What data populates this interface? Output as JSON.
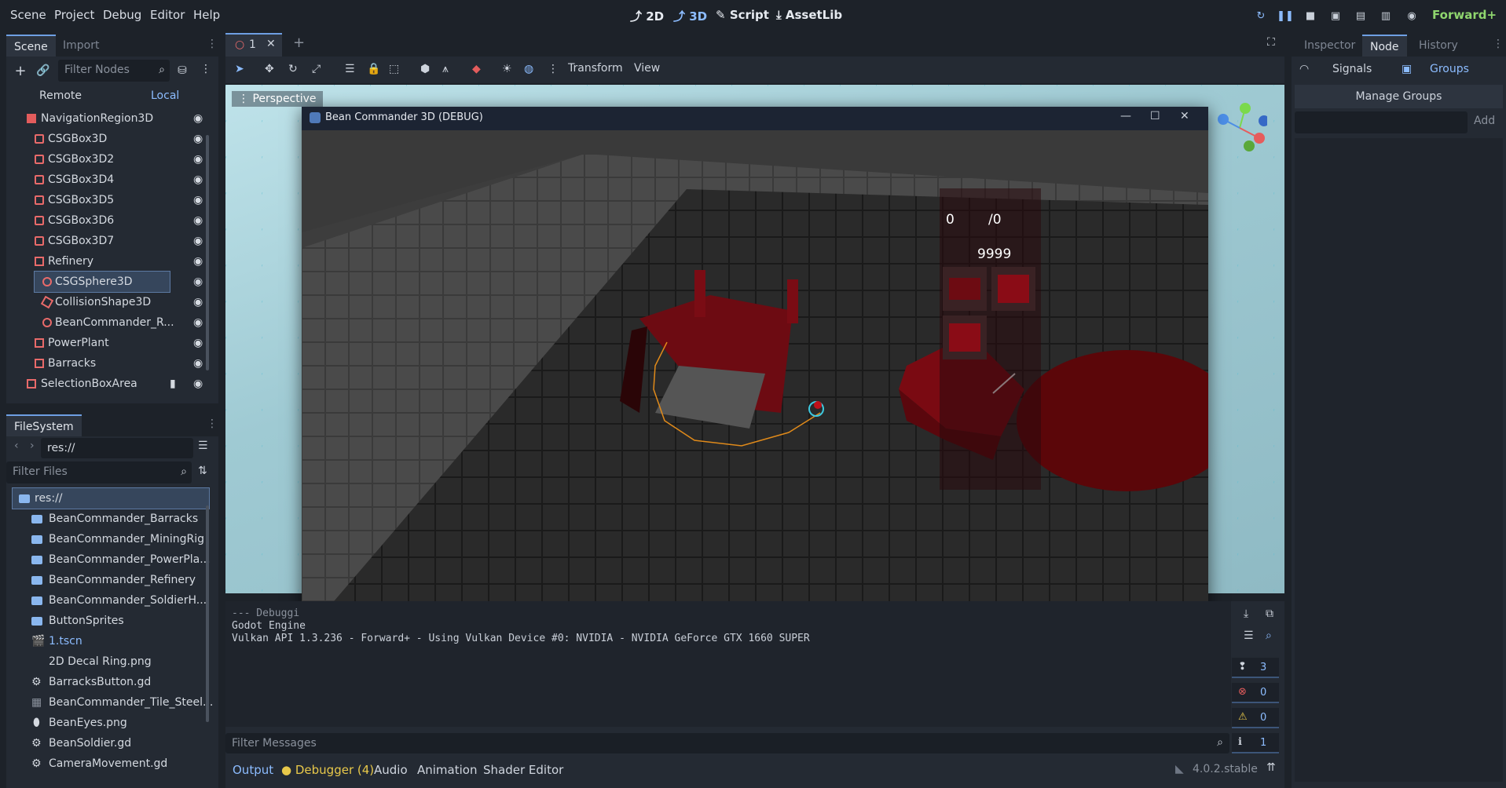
{
  "menu": [
    "Scene",
    "Project",
    "Debug",
    "Editor",
    "Help"
  ],
  "modes": [
    {
      "label": "2D"
    },
    {
      "label": "3D"
    },
    {
      "label": "Script"
    },
    {
      "label": "AssetLib"
    }
  ],
  "renderer": "Forward+",
  "scene_dock": {
    "tabs": [
      "Scene",
      "Import"
    ],
    "filter_placeholder": "Filter Nodes",
    "remote": "Remote",
    "local": "Local",
    "nodes": [
      {
        "label": "NavigationRegion3D"
      },
      {
        "label": "CSGBox3D"
      },
      {
        "label": "CSGBox3D2"
      },
      {
        "label": "CSGBox3D4"
      },
      {
        "label": "CSGBox3D5"
      },
      {
        "label": "CSGBox3D6"
      },
      {
        "label": "CSGBox3D7"
      },
      {
        "label": "Refinery"
      },
      {
        "label": "CSGSphere3D"
      },
      {
        "label": "CollisionShape3D"
      },
      {
        "label": "BeanCommander_R..."
      },
      {
        "label": "PowerPlant"
      },
      {
        "label": "Barracks"
      },
      {
        "label": "SelectionBoxArea"
      }
    ]
  },
  "filesystem": {
    "tab": "FileSystem",
    "path": "res://",
    "filter_placeholder": "Filter Files",
    "items": [
      {
        "label": "res://"
      },
      {
        "label": "BeanCommander_Barracks"
      },
      {
        "label": "BeanCommander_MiningRig"
      },
      {
        "label": "BeanCommander_PowerPla..."
      },
      {
        "label": "BeanCommander_Refinery"
      },
      {
        "label": "BeanCommander_SoldierH..."
      },
      {
        "label": "ButtonSprites"
      },
      {
        "label": "1.tscn"
      },
      {
        "label": "2D Decal Ring.png"
      },
      {
        "label": "BarracksButton.gd"
      },
      {
        "label": "BeanCommander_Tile_Steel..."
      },
      {
        "label": "BeanEyes.png"
      },
      {
        "label": "BeanSoldier.gd"
      },
      {
        "label": "CameraMovement.gd"
      }
    ]
  },
  "editor_tab": {
    "label": "1"
  },
  "toolbar": {
    "transform": "Transform",
    "view": "View"
  },
  "viewport": {
    "label": "Perspective"
  },
  "game_window": {
    "title": "Bean Commander 3D (DEBUG)",
    "hud": {
      "left_count": "0",
      "right_count": "/0",
      "money": "9999"
    }
  },
  "output": {
    "lines": [
      "--- Debuggi",
      "Godot Engine",
      "Vulkan API 1.3.236 - Forward+ - Using Vulkan Device #0: NVIDIA - NVIDIA GeForce GTX 1660 SUPER"
    ],
    "filter_placeholder": "Filter Messages",
    "counts": {
      "messages": "3",
      "errors": "0",
      "warnings": "0",
      "info": "1"
    }
  },
  "bottom_tabs": [
    "Output",
    "Debugger (4)",
    "Audio",
    "Animation",
    "Shader Editor"
  ],
  "version": "4.0.2.stable",
  "inspector": {
    "tabs": [
      "Inspector",
      "Node",
      "History"
    ],
    "signals": "Signals",
    "groups": "Groups",
    "manage_groups": "Manage Groups",
    "add": "Add"
  }
}
